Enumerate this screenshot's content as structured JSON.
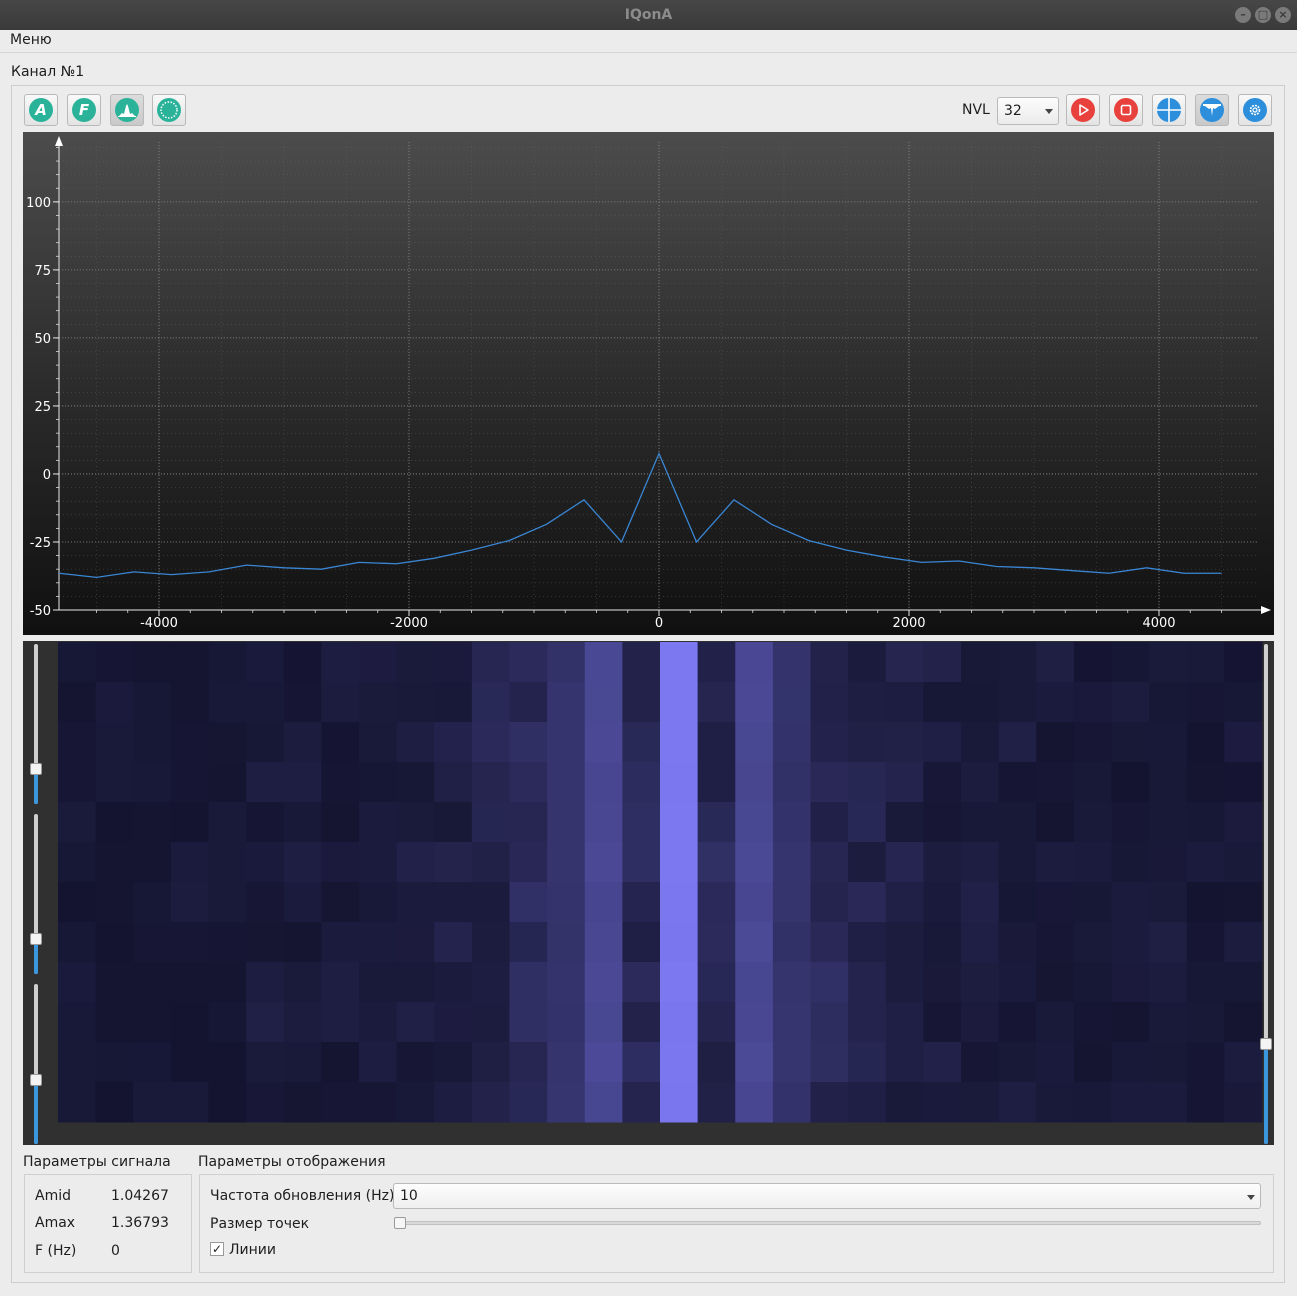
{
  "window": {
    "title": "IQonA"
  },
  "menu": {
    "label": "Меню"
  },
  "channel": {
    "title": "Канал №1"
  },
  "toolbar": {
    "left_buttons": [
      {
        "name": "amplitude-mode",
        "glyph": "A"
      },
      {
        "name": "frequency-mode",
        "glyph": "F"
      },
      {
        "name": "spectrum-mode",
        "glyph": ""
      },
      {
        "name": "constellation-mode",
        "glyph": ""
      }
    ],
    "nvl_label": "NVL",
    "nvl_value": "32",
    "right_buttons": [
      "play-icon",
      "stop-icon",
      "crosshair-icon",
      "waterfall-icon",
      "settings-icon"
    ]
  },
  "chart_data": {
    "type": "line",
    "title": "",
    "xlabel": "",
    "ylabel": "",
    "xlim": [
      -4800,
      4800
    ],
    "ylim": [
      -50,
      122
    ],
    "xticks": [
      -4000,
      -2000,
      0,
      2000,
      4000
    ],
    "yticks": [
      -50,
      -25,
      0,
      25,
      50,
      75,
      100
    ],
    "grid": true,
    "series": [
      {
        "color": "#3a86d4",
        "x": [
          -4800,
          -4500,
          -4200,
          -3900,
          -3600,
          -3300,
          -3000,
          -2700,
          -2400,
          -2100,
          -1800,
          -1500,
          -1200,
          -900,
          -600,
          -300,
          0,
          300,
          600,
          900,
          1200,
          1500,
          1800,
          2100,
          2400,
          2700,
          3000,
          3300,
          3600,
          3900,
          4200,
          4500
        ],
        "y": [
          -36.5,
          -38,
          -36,
          -37,
          -36,
          -33.5,
          -34.5,
          -35,
          -32.5,
          -33,
          -31,
          -28,
          -24.5,
          -18.5,
          -9.5,
          -25,
          7.5,
          -25,
          -9.5,
          -18.5,
          -24.5,
          -28,
          -30.5,
          -32.5,
          -32,
          -34,
          -34.5,
          -35.5,
          -36.5,
          -34.5,
          -36.5,
          -36.5
        ]
      }
    ]
  },
  "waterfall": {
    "peak_color": "#7b78f0",
    "base_color": "#272750",
    "sliders_left": [
      0.22,
      0.22,
      0.4
    ],
    "slider_right": 0.2
  },
  "signal_params": {
    "title": "Параметры сигнала",
    "rows": [
      {
        "name": "Amid",
        "value": "1.04267"
      },
      {
        "name": "Amax",
        "value": "1.36793"
      },
      {
        "name": "F (Hz)",
        "value": "0"
      }
    ]
  },
  "display_params": {
    "title": "Параметры отображения",
    "refresh_label": "Частота обновления (Hz)",
    "refresh_value": "10",
    "point_size_label": "Размер точек",
    "point_size_value": 0,
    "lines_label": "Линии",
    "lines_checked": true
  }
}
